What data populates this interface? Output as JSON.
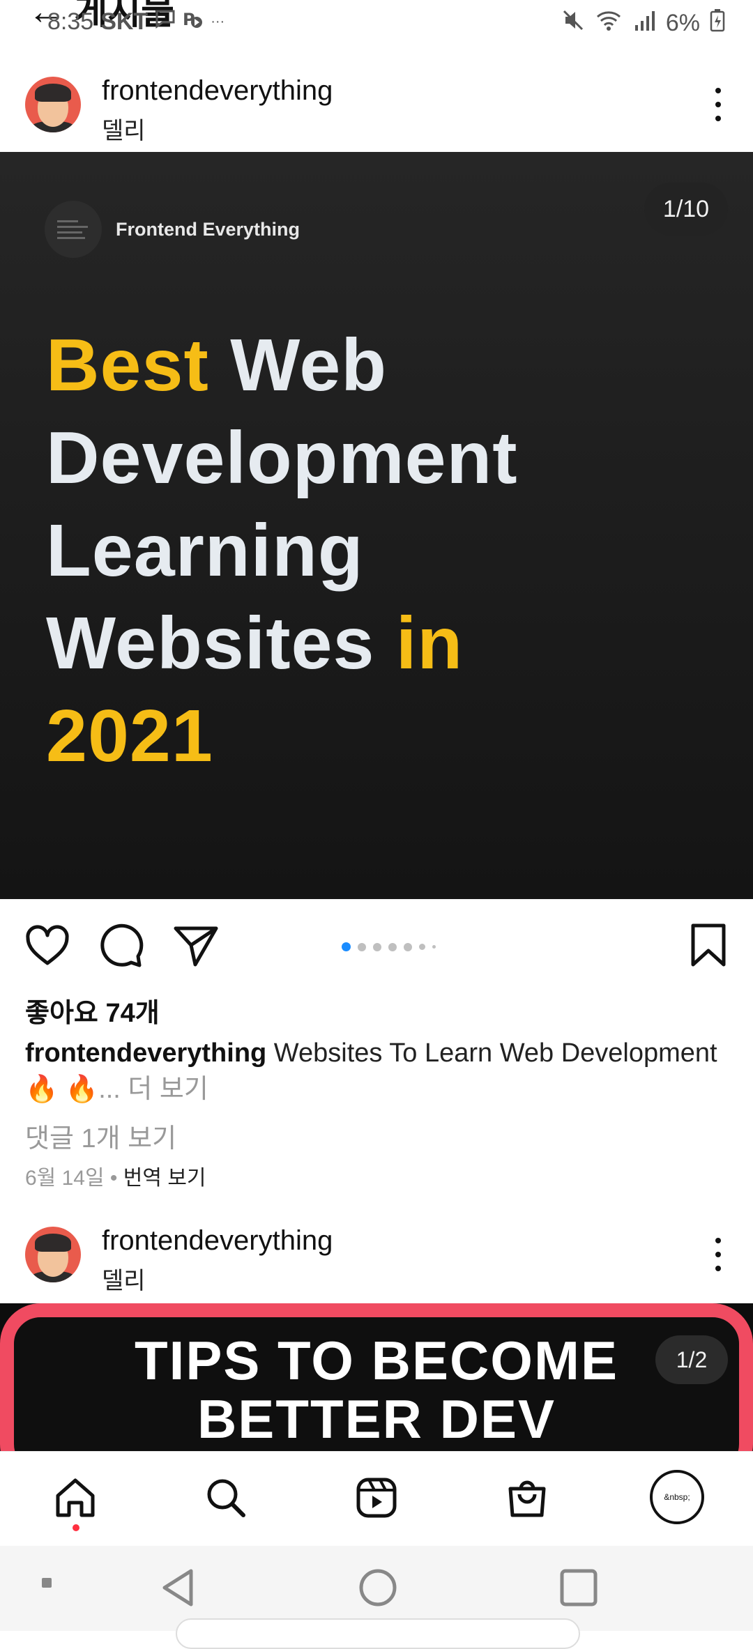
{
  "status_bar": {
    "time": "8:35",
    "carrier": "SKT",
    "overlap_title": "← 게시물",
    "battery": "6%"
  },
  "post1": {
    "username": "frontendeverything",
    "location": "델리",
    "image": {
      "brand_name": "Frontend Everything",
      "counter": "1/10",
      "headline": {
        "line1_yellow": "Best",
        "line1_rest": " Web",
        "line2": "Development",
        "line3": "Learning",
        "line4_white": "Websites ",
        "line4_yellow": "in",
        "line5_yellow": "2021"
      }
    },
    "carousel": {
      "total_dots": 7,
      "active_index": 0
    },
    "likes": "좋아요 74개",
    "caption": {
      "username": "frontendeverything",
      "text": " Websites To Learn Web Development",
      "emoji": "🔥 🔥",
      "more": "... 더 보기"
    },
    "comments": "댓글 1개 보기",
    "date": "6월 14일",
    "separator": " • ",
    "translate": "번역 보기"
  },
  "post2": {
    "username": "frontendeverything",
    "location": "델리",
    "title_line1": "TIPS TO BECOME",
    "title_line2": "BETTER DEV",
    "counter": "1/2"
  },
  "bottom_nav": {
    "profile_placeholder": "&nbsp;"
  },
  "colors": {
    "accent_yellow": "#f6bd16",
    "active_dot": "#1a8cff",
    "notification_dot": "#ff3040",
    "post2_border": "#f04b61"
  }
}
